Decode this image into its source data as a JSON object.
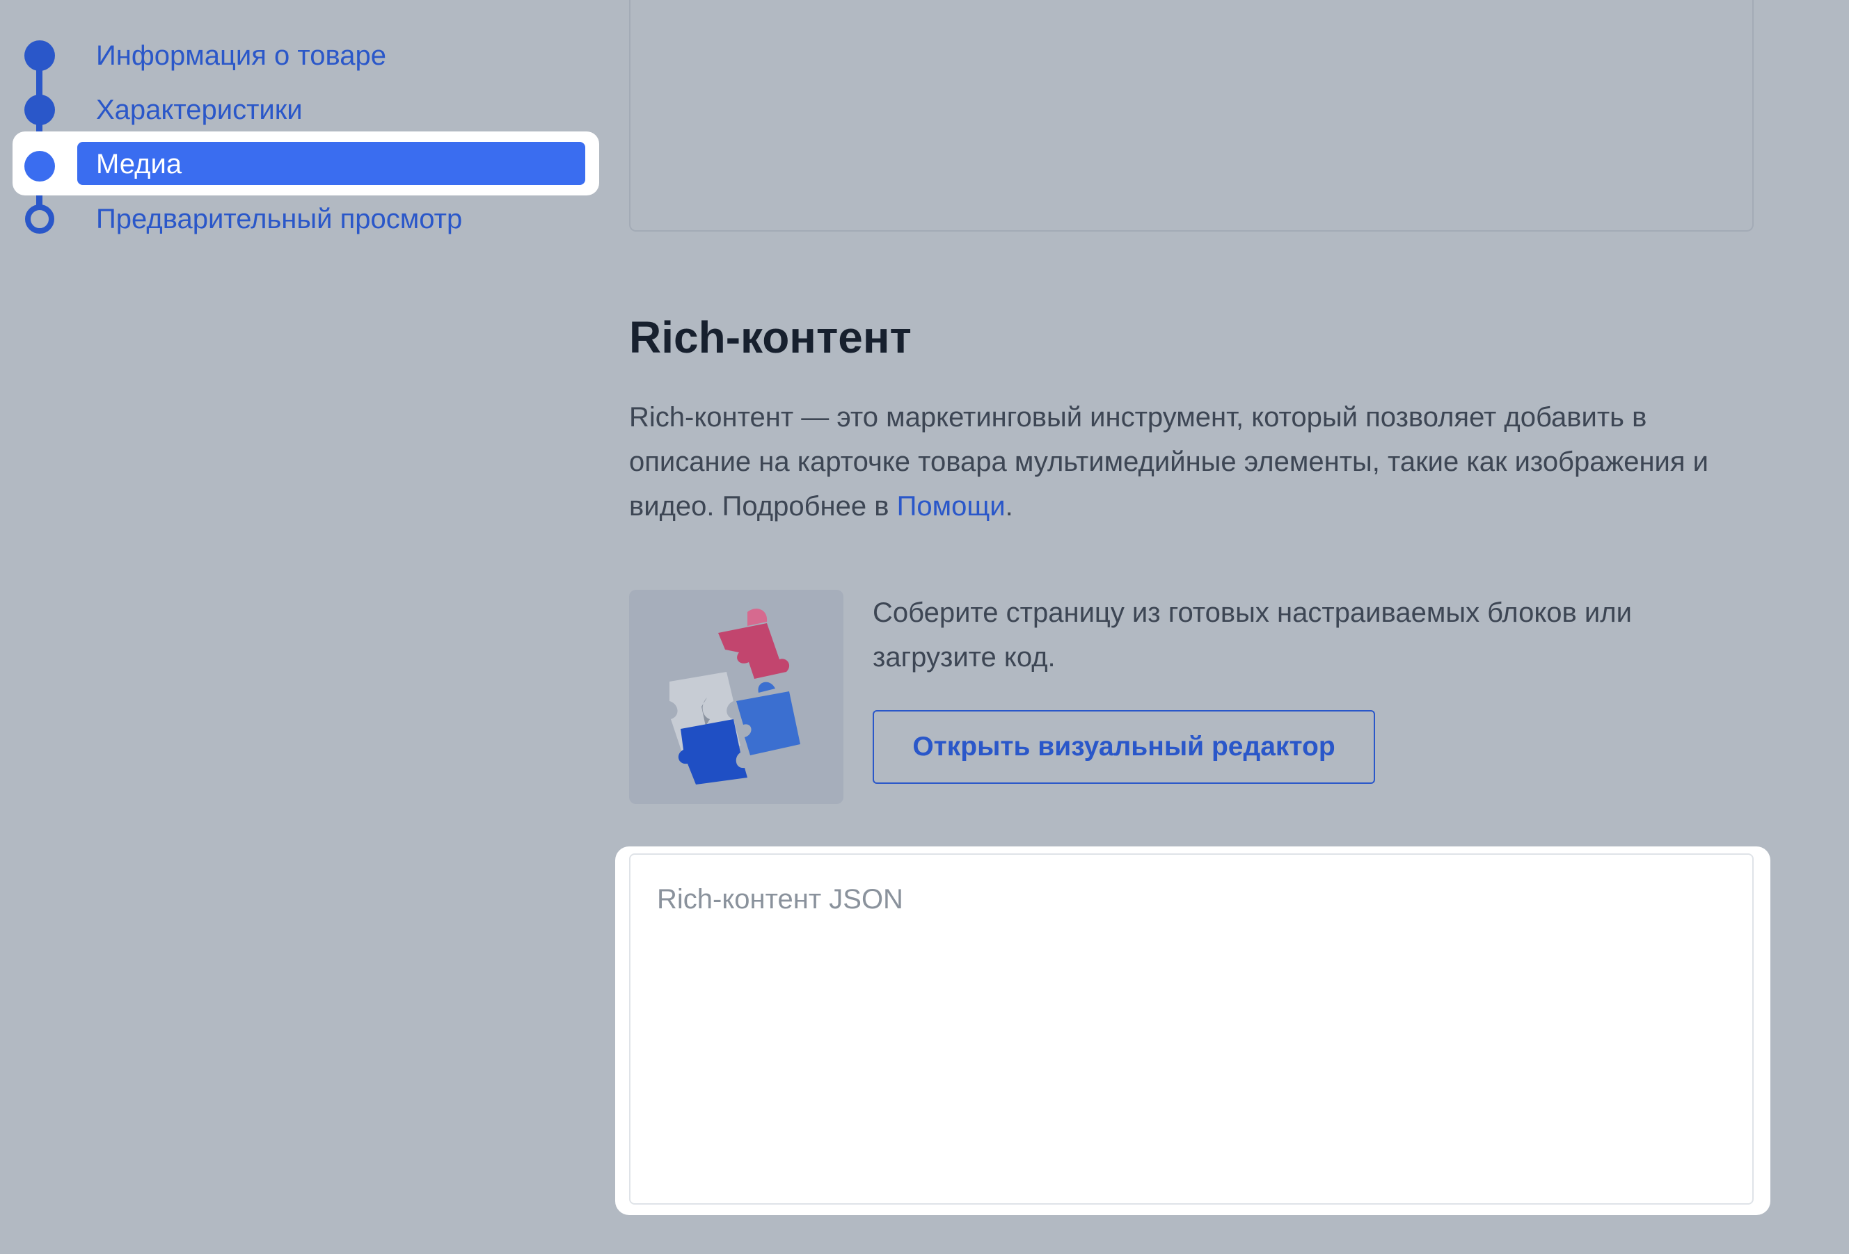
{
  "stepper": {
    "steps": [
      {
        "label": "Информация о товаре",
        "state": "done"
      },
      {
        "label": "Характеристики",
        "state": "done"
      },
      {
        "label": "Медиа",
        "state": "active"
      },
      {
        "label": "Предварительный просмотр",
        "state": "pending"
      }
    ]
  },
  "rich_content": {
    "title": "Rich-контент",
    "description": "Rich-контент — это маркетинговый инструмент, который позволяет добавить в описание на карточке товара мультимедийные элементы, такие как изображения и видео. Подробнее в ",
    "help_link": "Помощи",
    "description_end": ".",
    "promo_text": "Соберите страницу из готовых настраиваемых блоков или загрузите код.",
    "open_editor_button": "Открыть визуальный редактор",
    "json_field": {
      "placeholder": "Rich-контент JSON",
      "value": ""
    }
  },
  "colors": {
    "background": "#b2b9c2",
    "accent": "#2a57c9",
    "active_step": "#3a6df0",
    "puzzle_pink": "#c2456e",
    "puzzle_blue": "#1f4fc4"
  },
  "icons": {
    "promo_illustration": "puzzle-pieces-icon"
  }
}
